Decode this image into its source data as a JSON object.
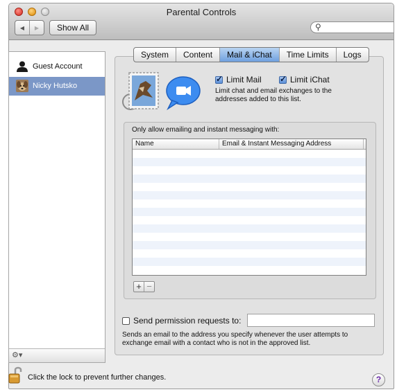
{
  "window": {
    "title": "Parental Controls"
  },
  "toolbar": {
    "show_all_label": "Show All",
    "back_icon": "arrow-left",
    "forward_icon": "arrow-right",
    "search_placeholder": ""
  },
  "sidebar": {
    "users": [
      {
        "name": "Guest Account",
        "icon": "person-silhouette",
        "selected": false
      },
      {
        "name": "Nicky Hutsko",
        "icon": "dog-photo",
        "selected": true
      }
    ],
    "gear_label": "⚙▾"
  },
  "tabs": [
    {
      "label": "System",
      "active": false
    },
    {
      "label": "Content",
      "active": false
    },
    {
      "label": "Mail & iChat",
      "active": true
    },
    {
      "label": "Time Limits",
      "active": false
    },
    {
      "label": "Logs",
      "active": false
    }
  ],
  "mail_ichat": {
    "limit_mail": {
      "label": "Limit Mail",
      "checked": true
    },
    "limit_ichat": {
      "label": "Limit iChat",
      "checked": true
    },
    "description": "Limit chat and email exchanges to the addresses added to this list.",
    "group_label": "Only allow emailing and instant messaging with:",
    "table": {
      "columns": [
        "Name",
        "Email & Instant Messaging Address"
      ],
      "rows": []
    },
    "add_label": "+",
    "remove_label": "−",
    "permission": {
      "label": "Send permission requests to:",
      "checked": false,
      "value": "",
      "description": "Sends an email to the address you specify whenever the user attempts to exchange email with a contact who is not in the approved list."
    }
  },
  "footer": {
    "lock_text": "Click the lock to prevent further changes.",
    "help_label": "?"
  },
  "colors": {
    "selection": "#7b97c7",
    "tab_active": "#6fa0df",
    "window_bg": "#ececec"
  }
}
